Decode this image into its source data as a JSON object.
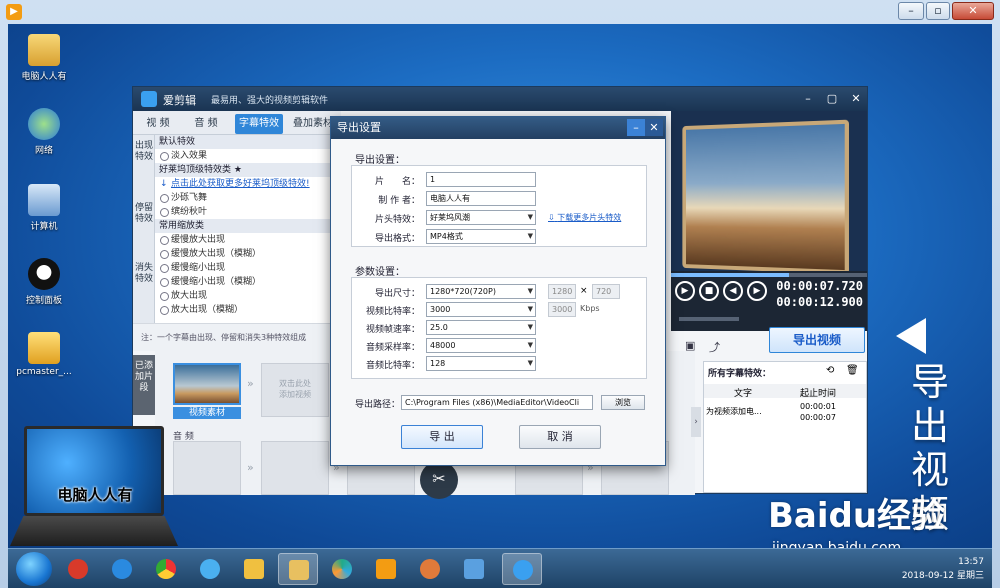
{
  "desktop_icons": [
    {
      "label": "电脑人人有",
      "icon": "folder-icon"
    },
    {
      "label": "网络",
      "icon": "network-icon"
    },
    {
      "label": "计算机",
      "icon": "computer-icon"
    },
    {
      "label": "控制面板",
      "icon": "control-panel-icon"
    },
    {
      "label": "pcmaster_...",
      "icon": "media-file-icon"
    }
  ],
  "app": {
    "name": "爱剪辑",
    "slogan": "最易用、强大的视频剪辑软件",
    "tabs": [
      "视 频",
      "音 频",
      "字幕特效",
      "叠加素材"
    ],
    "active_tab": "字幕特效",
    "side_tabs": [
      "出现特效",
      "停留特效",
      "消失特效"
    ],
    "effects": [
      {
        "type": "group",
        "text": "默认特效"
      },
      {
        "type": "item",
        "text": "淡入效果"
      },
      {
        "type": "group",
        "text": "好莱坞顶级特效类 ★"
      },
      {
        "type": "link",
        "text": "点击此处获取更多好莱坞顶级特效!"
      },
      {
        "type": "item",
        "text": "沙砾飞舞"
      },
      {
        "type": "item",
        "text": "缤纷秋叶"
      },
      {
        "type": "group",
        "text": "常用缩放类"
      },
      {
        "type": "item",
        "text": "缓慢放大出现"
      },
      {
        "type": "item",
        "text": "缓慢放大出现（模糊）"
      },
      {
        "type": "item",
        "text": "缓慢缩小出现"
      },
      {
        "type": "item",
        "text": "缓慢缩小出现（模糊）"
      },
      {
        "type": "item",
        "text": "放大出现"
      },
      {
        "type": "item",
        "text": "放大出现（模糊）"
      }
    ],
    "hint": "注：一个字幕由出现、停留和消失3种特效组成",
    "added_clips_label": "已添加片段",
    "clip_label": "视频素材",
    "add_video_slot": "双击此处\n添加视频",
    "audio_label": "音 频",
    "timecode_current": "00:00:07.720",
    "timecode_total": "00:00:12.900",
    "progress": 0.6,
    "export_video_label": "导出视频",
    "subs_title": "所有字幕特效：",
    "subs_col_text": "文字",
    "subs_col_time": "起止时间",
    "subs_row_text": "为视频添加电...",
    "subs_row_start": "00:00:01",
    "subs_row_end": "00:00:07"
  },
  "dialog": {
    "title": "导出设置",
    "section_export": "导出设置：",
    "name_label": "片　　名：",
    "name_value": "1",
    "author_label": "制 作 者：",
    "author_value": "电脑人人有",
    "intro_label": "片头特效：",
    "intro_value": "好莱坞风潮",
    "download_more": "下载更多片头特效",
    "format_label": "导出格式：",
    "format_value": "MP4格式",
    "section_params": "参数设置：",
    "size_label": "导出尺寸：",
    "size_value": "1280*720(720P)",
    "size_w": "1280",
    "size_x": "×",
    "size_h": "720",
    "vbitrate_label": "视频比特率：",
    "vbitrate_value": "3000",
    "vbitrate_custom": "3000",
    "vbitrate_unit": "Kbps",
    "fps_label": "视频帧速率：",
    "fps_value": "25.0",
    "asample_label": "音频采样率：",
    "asample_value": "48000",
    "abitrate_label": "音频比特率：",
    "abitrate_value": "128",
    "path_label": "导出路径：",
    "path_value": "C:\\Program Files (x86)\\MediaEditor\\VideoCli",
    "browse_label": "浏览",
    "export_label": "导 出",
    "cancel_label": "取 消"
  },
  "overlay": {
    "side_caption": "导出视频",
    "laptop_text": "电脑人人有",
    "watermark": "Baidu经验",
    "watermark_url": "jingyan.baidu.com"
  },
  "taskbar": {
    "time": "13:57",
    "date": "2018-09-12 星期三"
  }
}
